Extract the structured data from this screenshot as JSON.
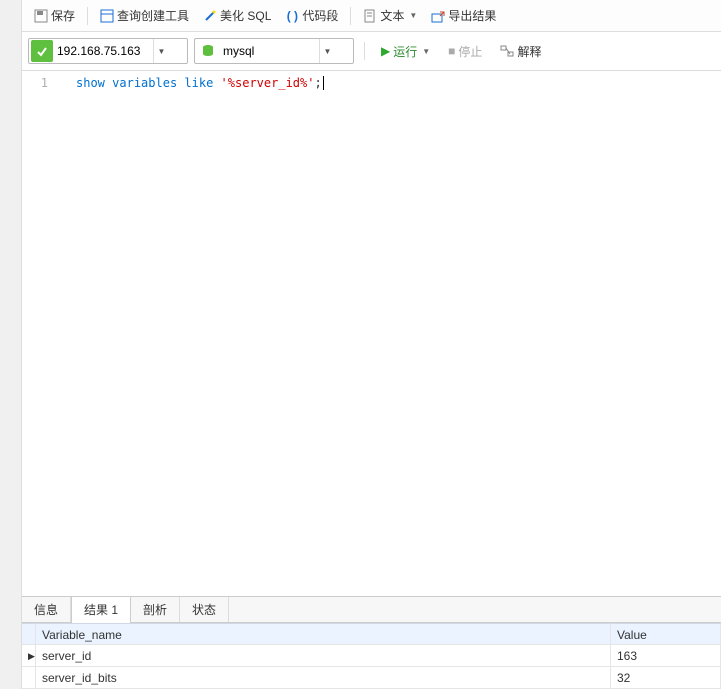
{
  "toolbar": {
    "save": "保存",
    "query_builder": "查询创建工具",
    "beautify_sql": "美化 SQL",
    "code_snip": "代码段",
    "text": "文本",
    "export": "导出结果"
  },
  "row2": {
    "conn_value": "192.168.75.163",
    "db_value": "mysql",
    "run": "运行",
    "stop": "停止",
    "explain": "解释"
  },
  "editor": {
    "line_no": "1",
    "kw1": "show",
    "kw2": "variables",
    "kw3": "like",
    "str": "'%server_id%'",
    "tail": ";"
  },
  "tabs": {
    "info": "信息",
    "result1": "结果 1",
    "profile": "剖析",
    "status": "状态"
  },
  "grid": {
    "headers": {
      "c1": "Variable_name",
      "c2": "Value"
    },
    "rows": [
      {
        "ptr": "▶",
        "c1": "server_id",
        "c2": "163"
      },
      {
        "ptr": "",
        "c1": "server_id_bits",
        "c2": "32"
      }
    ]
  }
}
